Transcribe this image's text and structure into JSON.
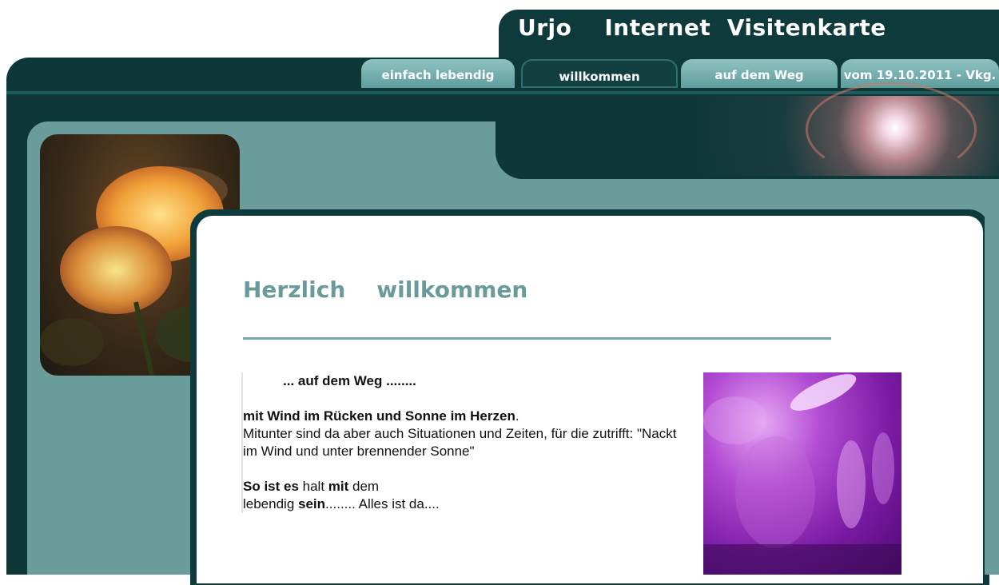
{
  "header": {
    "title": "Urjo    Internet  Visitenkarte"
  },
  "tabs": [
    {
      "label": "einfach lebendig"
    },
    {
      "label": "willkommen"
    },
    {
      "label": "auf dem Weg"
    },
    {
      "label": "vom 19.10.2011 - Vkg."
    }
  ],
  "main": {
    "heading": "Herzlich    willkommen",
    "subtitle": "... auf dem Weg ........",
    "p1_bold": "mit Wind im Rücken und  Sonne im Herzen",
    "p1_rest": ".",
    "p2": "Mitunter sind da aber auch Situationen und Zeiten, für die zutrifft:  \"Nackt im Wind und unter brennender Sonne\"",
    "p3_a": "So ist es",
    "p3_b": " halt ",
    "p3_c": "mit",
    "p3_d": " dem",
    "p4_a": "lebendig ",
    "p4_b": "sein",
    "p4_c": "........  Alles ist da...."
  },
  "colors": {
    "dark_teal": "#0e3738",
    "teal": "#6a9c9c",
    "heading_teal": "#6b9a9a"
  }
}
